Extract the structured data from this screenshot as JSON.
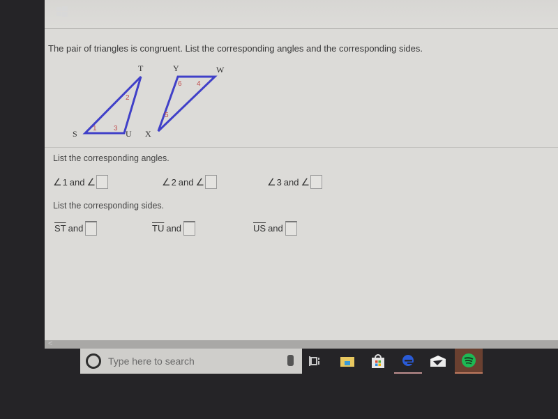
{
  "question": "The pair of triangles is congruent. List the corresponding angles and the corresponding sides.",
  "figure": {
    "triangle1": {
      "vertices": [
        "S",
        "T",
        "U"
      ],
      "angle_labels": [
        "1",
        "2",
        "3"
      ]
    },
    "triangle2": {
      "vertices": [
        "Y",
        "W",
        "X"
      ],
      "angle_labels": [
        "6",
        "4",
        "5"
      ]
    },
    "line_color": "#4040c8",
    "angle_label_color": "#c05050"
  },
  "angles_section": {
    "label": "List the corresponding angles.",
    "items": [
      {
        "given": "1",
        "and": "and",
        "answer": ""
      },
      {
        "given": "2",
        "and": "and",
        "answer": ""
      },
      {
        "given": "3",
        "and": "and",
        "answer": ""
      }
    ],
    "angle_symbol": "∠"
  },
  "sides_section": {
    "label": "List the corresponding sides.",
    "items": [
      {
        "given": "ST",
        "and": "and",
        "answer": ""
      },
      {
        "given": "TU",
        "and": "and",
        "answer": ""
      },
      {
        "given": "US",
        "and": "and",
        "answer": ""
      }
    ]
  },
  "scrollbar": {
    "left_arrow": "<"
  },
  "taskbar": {
    "search_placeholder": "Type here to search",
    "icons": [
      "windows-start-icon",
      "cortana-icon",
      "microphone-icon",
      "task-view-icon",
      "file-explorer-icon",
      "store-icon",
      "edge-icon",
      "mail-icon",
      "spotify-icon"
    ],
    "spotify_color": "#1db954",
    "edge_color": "#2a5bd7"
  }
}
